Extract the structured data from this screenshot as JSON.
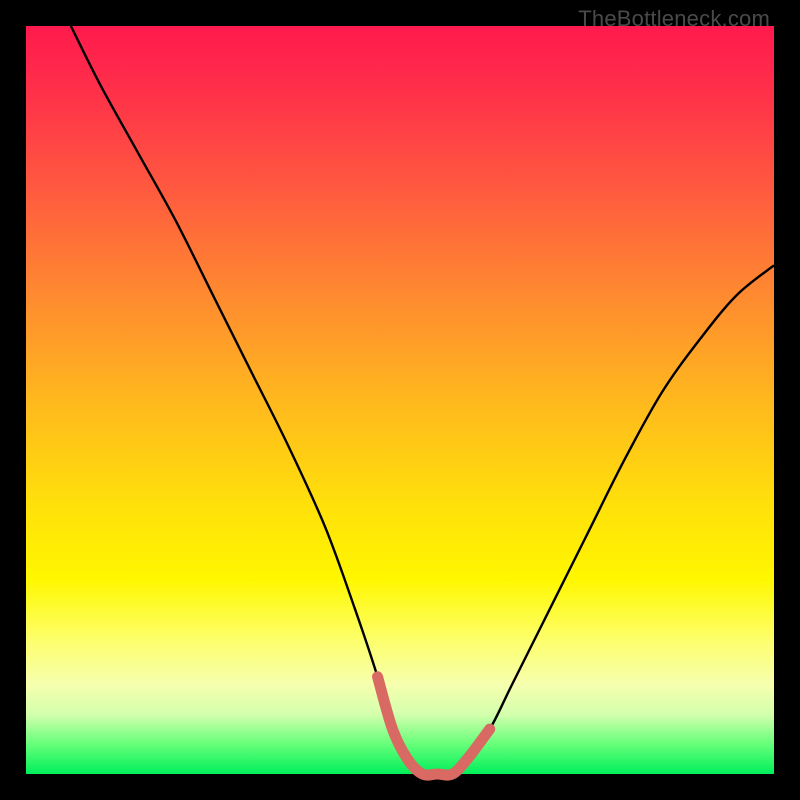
{
  "watermark": "TheBottleneck.com",
  "colors": {
    "frame": "#000000",
    "curve_black": "#000000",
    "curve_highlight": "#d86a63",
    "gradient_top": "#ff1a4d",
    "gradient_bottom": "#00ef5a"
  },
  "chart_data": {
    "type": "line",
    "title": "",
    "xlabel": "",
    "ylabel": "",
    "xlim": [
      0,
      100
    ],
    "ylim": [
      0,
      100
    ],
    "grid": false,
    "series": [
      {
        "name": "bottleneck-curve",
        "x": [
          6,
          10,
          15,
          20,
          25,
          30,
          35,
          40,
          44,
          47,
          49,
          51,
          53,
          55,
          57,
          59,
          62,
          65,
          70,
          75,
          80,
          85,
          90,
          95,
          100
        ],
        "y": [
          100,
          92,
          83,
          74,
          64,
          54,
          44,
          33,
          22,
          13,
          6,
          2,
          0,
          0,
          0,
          2,
          6,
          12,
          22,
          32,
          42,
          51,
          58,
          64,
          68
        ]
      }
    ],
    "annotations": [
      {
        "text": "TheBottleneck.com",
        "position": "top-right"
      }
    ],
    "highlight_x_range": [
      47,
      62
    ]
  }
}
